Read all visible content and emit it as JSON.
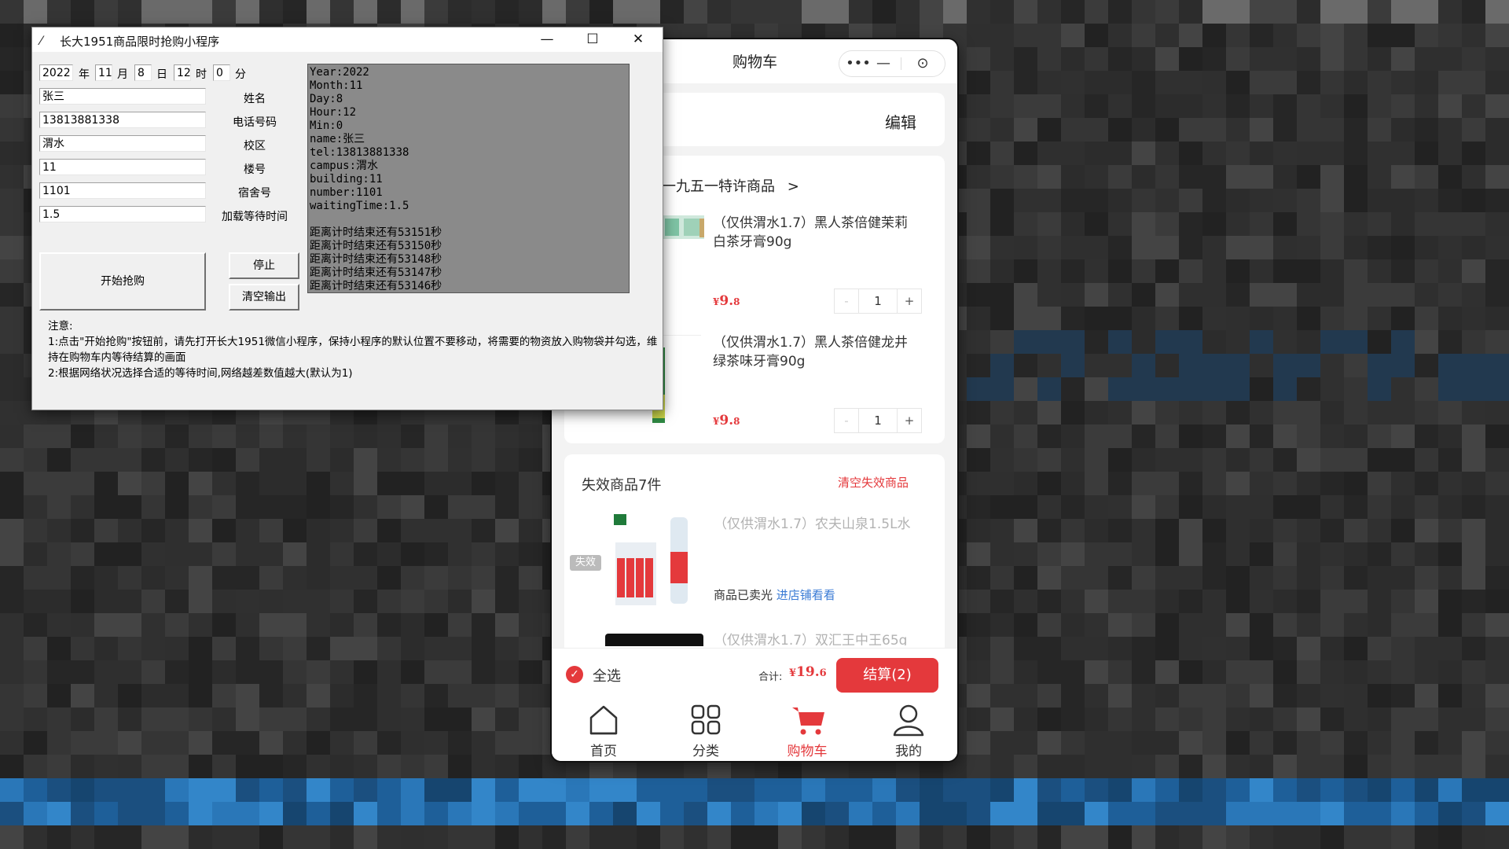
{
  "tk_window": {
    "title": "长大1951商品限时抢购小程序",
    "title_buttons": [
      "—",
      "☐",
      "✕"
    ],
    "date_fields": {
      "year": "2022",
      "year_unit": "年",
      "month": "11",
      "month_unit": "月",
      "day": "8",
      "day_unit": "日",
      "hour": "12",
      "hour_unit": "时",
      "minute": "0",
      "minute_unit": "分"
    },
    "fields": [
      {
        "value": "张三",
        "label": "姓名"
      },
      {
        "value": "13813881338",
        "label": "电话号码"
      },
      {
        "value": "渭水",
        "label": "校区"
      },
      {
        "value": "11",
        "label": "楼号"
      },
      {
        "value": "1101",
        "label": "宿舍号"
      },
      {
        "value": "1.5",
        "label": "加载等待时间"
      }
    ],
    "start_button": "开始抢购",
    "stop_button": "停止",
    "clear_button": "清空输出",
    "output_lines": [
      "Year:2022",
      "Month:11",
      "Day:8",
      "Hour:12",
      "Min:0",
      "name:张三",
      "tel:13813881338",
      "campus:渭水",
      "building:11",
      "number:1101",
      "waitingTime:1.5",
      "",
      "距离计时结束还有53151秒",
      "距离计时结束还有53150秒",
      "距离计时结束还有53148秒",
      "距离计时结束还有53147秒",
      "距离计时结束还有53146秒"
    ],
    "notes": [
      "注意:",
      "1:点击\"开始抢购\"按钮前，请先打开长大1951微信小程序，保持小程序的默认位置不要移动，将需要的物资放入购物袋并勾选，维持在购物车内等待结算的画面",
      "2:根据网络状况选择合适的等待时间,网络越差数值越大(默认为1)"
    ]
  },
  "mini_program": {
    "page_title": "购物车",
    "capsule": {
      "more": "•••",
      "minimize": "—",
      "close": "⊙"
    },
    "edit": "编辑",
    "shop": {
      "name": "一九五一特许商品",
      "arrow": ">"
    },
    "items": [
      {
        "title": "（仅供渭水1.7）黑人茶倍健茉莉白茶牙膏90g",
        "currency": "¥",
        "price_int": "9.",
        "price_dec": "8",
        "qty": "1",
        "minus": "-",
        "plus": "+"
      },
      {
        "title": "（仅供渭水1.7）黑人茶倍健龙井绿茶味牙膏90g",
        "currency": "¥",
        "price_int": "9.",
        "price_dec": "8",
        "qty": "1",
        "minus": "-",
        "plus": "+"
      }
    ],
    "invalid": {
      "title": "失效商品7件",
      "clear": "清空失效商品",
      "badge": "失效",
      "items": [
        {
          "title": "（仅供渭水1.7）农夫山泉1.5L水"
        },
        {
          "title": "（仅供渭水1.7）双汇王中王65g"
        }
      ],
      "soldout_text": "商品已卖光",
      "soldout_link": "进店铺看看"
    },
    "bottom": {
      "select_all": "全选",
      "total_label": "合计:",
      "total_currency": "¥",
      "total_int": "19.",
      "total_dec": "6",
      "checkout": "结算(2)"
    },
    "tabs": [
      {
        "icon": "home-icon",
        "label": "首页"
      },
      {
        "icon": "grid-icon",
        "label": "分类"
      },
      {
        "icon": "cart-icon",
        "label": "购物车",
        "active": true
      },
      {
        "icon": "user-icon",
        "label": "我的"
      }
    ],
    "accent_color": "#e4393c"
  }
}
